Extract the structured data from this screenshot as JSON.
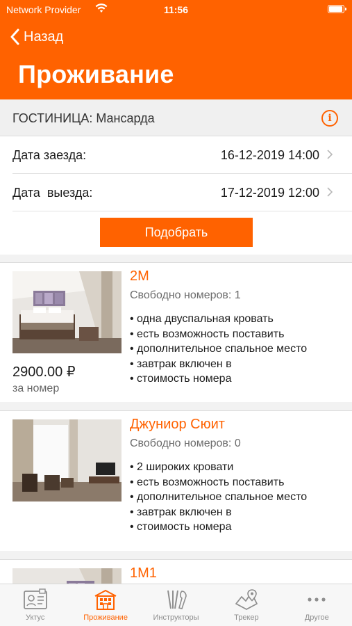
{
  "status_bar": {
    "carrier": "Network Provider",
    "time": "11:56",
    "battery_level": 0.95
  },
  "nav": {
    "back_label": "Назад",
    "title": "Проживание"
  },
  "hotel": {
    "label": "ГОСТИНИЦА: Мансарда"
  },
  "checkin": {
    "label": "Дата заезда:",
    "value": "16-12-2019 14:00"
  },
  "checkout": {
    "label": "Дата  выезда:",
    "value": "17-12-2019 12:00"
  },
  "select_button": "Подобрать",
  "rooms": [
    {
      "name": "2М",
      "available": "Свободно номеров: 1",
      "features": [
        "одна двуспальная кровать",
        "есть возможность поставить",
        "дополнительное спальное место",
        "завтрак включен в",
        "стоимость номера"
      ],
      "price": "2900.00 ₽",
      "per": "за номер"
    },
    {
      "name": "Джуниор Сюит",
      "available": "Свободно номеров: 0",
      "features": [
        "2 широких кровати",
        "есть возможность поставить",
        "дополнительное спальное место",
        "завтрак включен в",
        "стоимость номера"
      ]
    },
    {
      "name": "1М1"
    }
  ],
  "tabs": [
    {
      "label": "Уктус",
      "icon": "id-card-icon",
      "active": false
    },
    {
      "label": "Проживание",
      "icon": "hotel-icon",
      "active": true
    },
    {
      "label": "Инструкторы",
      "icon": "tools-icon",
      "active": false
    },
    {
      "label": "Трекер",
      "icon": "map-icon",
      "active": false
    },
    {
      "label": "Другое",
      "icon": "more-icon",
      "active": false
    }
  ],
  "colors": {
    "accent": "#ff6200",
    "inactive": "#8e8e8e"
  }
}
